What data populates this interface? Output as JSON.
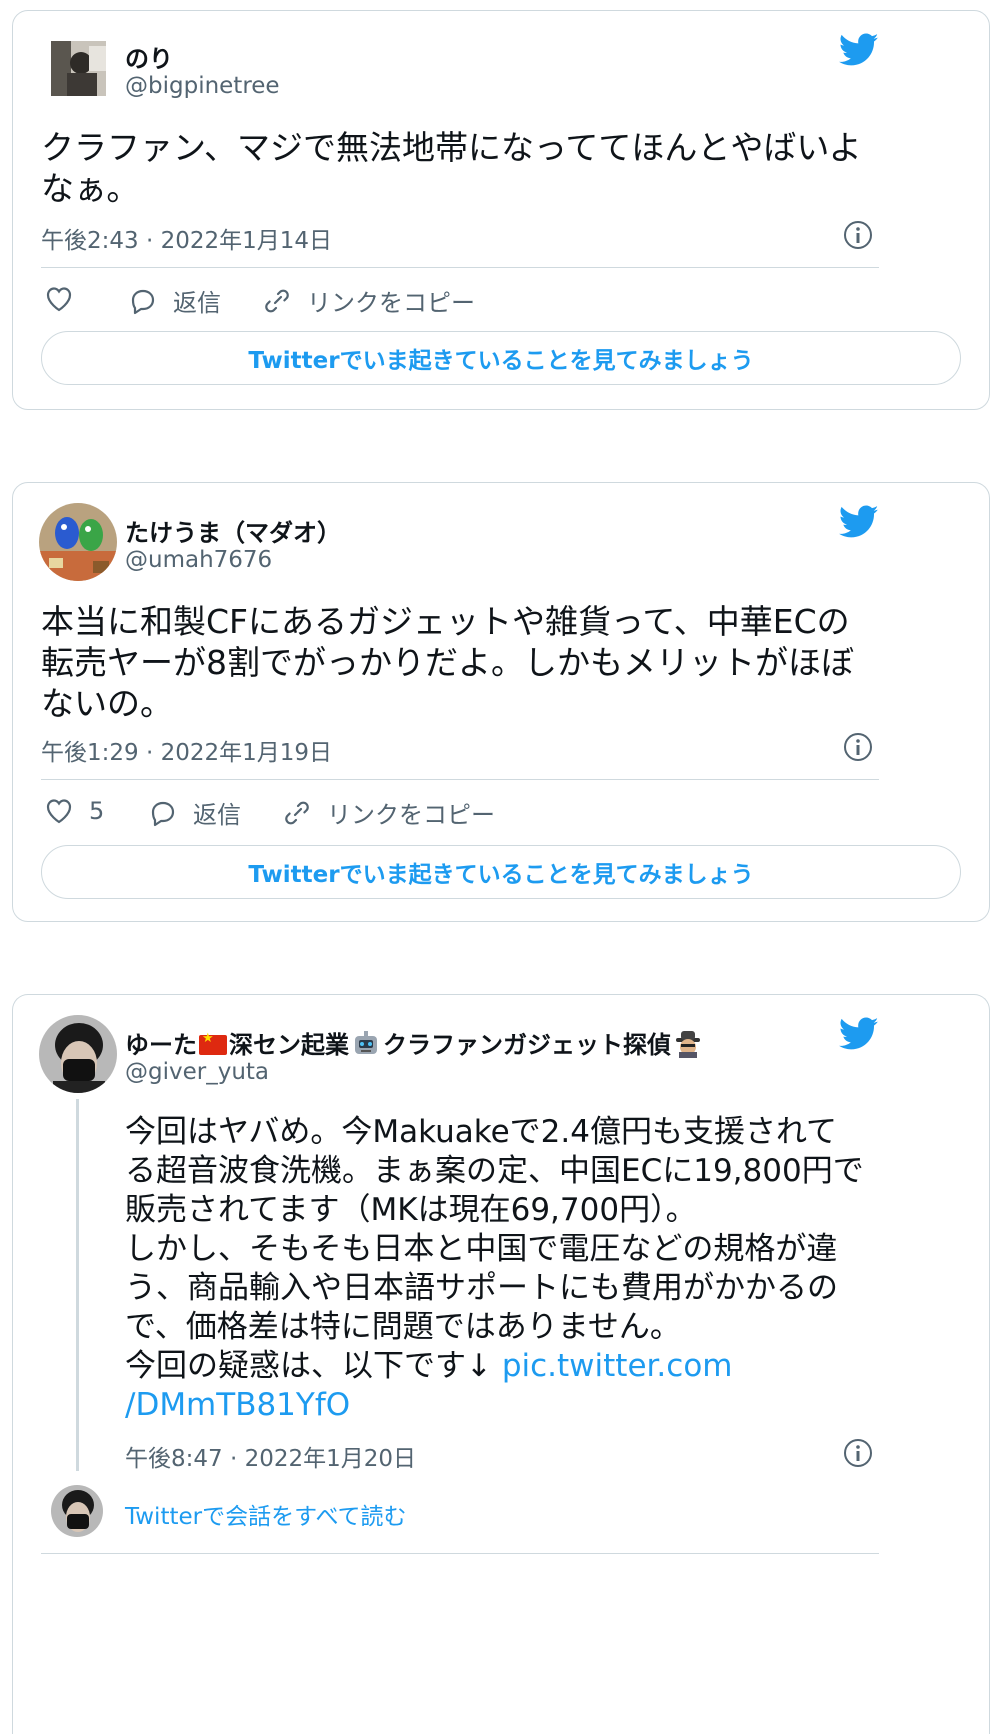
{
  "tweets": [
    {
      "name": "のり",
      "handle": "@bigpinetree",
      "text": "クラファン、マジで無法地帯になっててほんとやばいよなぁ。",
      "time": "午後2:43 · 2022年1月14日",
      "actions": {
        "like_count": "",
        "reply": "返信",
        "copy_link": "リンクをコピー"
      },
      "cta": "Twitterでいま起きていることを見てみましょう"
    },
    {
      "name": "たけうま（マダオ）",
      "handle": "@umah7676",
      "text": "本当に和製CFにあるガジェットや雑貨って、中華ECの転売ヤーが8割でがっかりだよ。しかもメリットがほぼないの。",
      "time": "午後1:29 · 2022年1月19日",
      "actions": {
        "like_count": "5",
        "reply": "返信",
        "copy_link": "リンクをコピー"
      },
      "cta": "Twitterでいま起きていることを見てみましょう"
    },
    {
      "name_part1": "ゆーた",
      "name_part2": "深セン起業",
      "name_part3": "クラファンガジェット探偵",
      "handle": "@giver_yuta",
      "text_lines": [
        "今回はヤバめ。今Makuakeで2.4億円も支援されて",
        "る超音波食洗機。まぁ案の定、中国ECに19,800円で",
        "販売されてます（MKは現在69,700円）。",
        "しかし、そもそも日本と中国で電圧などの規格が違",
        "う、商品輸入や日本語サポートにも費用がかかるの",
        "で、価格差は特に問題ではありません。",
        "今回の疑惑は、以下です↓ "
      ],
      "link_part1": "pic.twitter.com",
      "link_part2": "/DMmTB81YfO",
      "time": "午後8:47 · 2022年1月20日",
      "read_all": "Twitterで会話をすべて読む"
    }
  ],
  "colors": {
    "accent": "#1d9bf0",
    "secondary_text": "#536471",
    "border": "#cfd9de"
  }
}
